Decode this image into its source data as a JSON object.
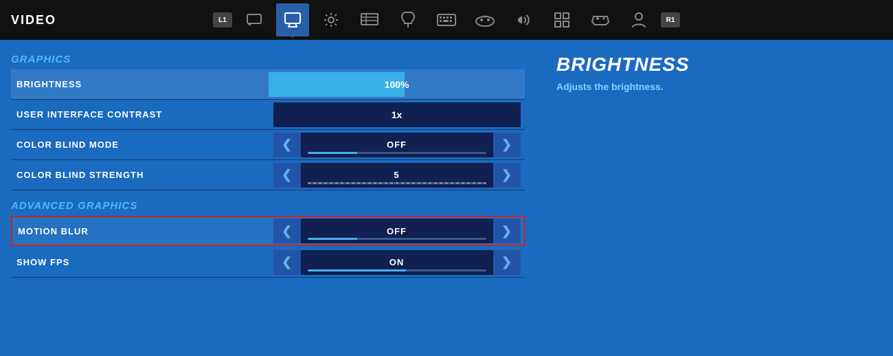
{
  "topBar": {
    "title": "VIDEO",
    "badges": {
      "left": "L1",
      "right": "R1"
    },
    "navIcons": [
      {
        "name": "chat-icon",
        "symbol": "💬",
        "active": false
      },
      {
        "name": "monitor-icon",
        "symbol": "🖥",
        "active": true
      },
      {
        "name": "gear-icon",
        "symbol": "⚙",
        "active": false
      },
      {
        "name": "display-icon",
        "symbol": "📺",
        "active": false
      },
      {
        "name": "touch-icon",
        "symbol": "☎",
        "active": false
      },
      {
        "name": "keyboard-icon",
        "symbol": "⌨",
        "active": false
      },
      {
        "name": "gamepad-icon",
        "symbol": "🎮",
        "active": false
      },
      {
        "name": "speaker-icon",
        "symbol": "🔊",
        "active": false
      },
      {
        "name": "grid-icon",
        "symbol": "⊞",
        "active": false
      },
      {
        "name": "controller-icon",
        "symbol": "🎮",
        "active": false
      },
      {
        "name": "profile-icon",
        "symbol": "👤",
        "active": false
      }
    ]
  },
  "sections": {
    "graphics": {
      "title": "GRAPHICS",
      "rows": [
        {
          "label": "BRIGHTNESS",
          "type": "slider",
          "value": "100%",
          "fillPercent": 53,
          "selected": true
        },
        {
          "label": "USER INTERFACE CONTRAST",
          "type": "text",
          "value": "1x"
        },
        {
          "label": "COLOR BLIND MODE",
          "type": "arrow",
          "value": "OFF",
          "sliderType": "partial"
        },
        {
          "label": "COLOR BLIND STRENGTH",
          "type": "arrow",
          "value": "5",
          "sliderType": "dashed"
        }
      ]
    },
    "advancedGraphics": {
      "title": "ADVANCED GRAPHICS",
      "rows": [
        {
          "label": "MOTION BLUR",
          "type": "arrow",
          "value": "OFF",
          "sliderType": "partial",
          "highlighted": true
        },
        {
          "label": "SHOW FPS",
          "type": "arrow",
          "value": "ON",
          "sliderType": "none"
        }
      ]
    }
  },
  "infoPanel": {
    "title": "BRIGHTNESS",
    "description": "Adjusts the brightness."
  },
  "controls": {
    "arrowLeft": "❮",
    "arrowRight": "❯"
  }
}
